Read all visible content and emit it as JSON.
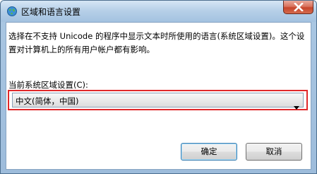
{
  "window": {
    "title": "区域和语言设置",
    "close_icon": "close-x-icon"
  },
  "dialog": {
    "description": "选择在不支持 Unicode 的程序中显示文本时所使用的语言(系统区域设置)。这个设置对计算机上的所有用户帐户都有影响。",
    "locale_label": "当前系统区域设置(C):",
    "locale_value": "中文(简体，中国)",
    "highlight_color": "#e0282a"
  },
  "buttons": {
    "ok_label": "确定",
    "cancel_label": "取消"
  }
}
